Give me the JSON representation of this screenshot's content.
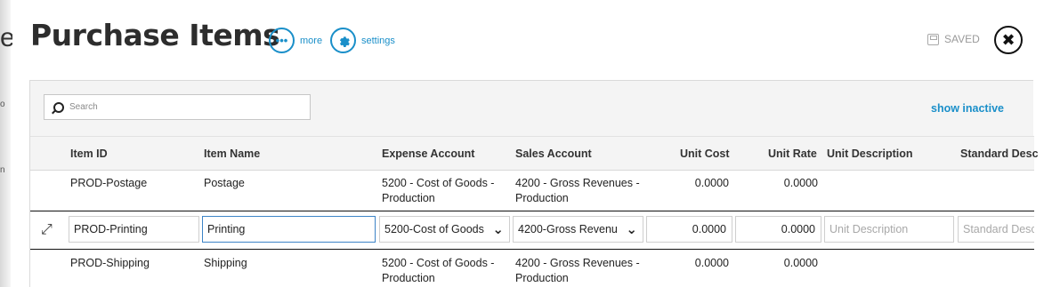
{
  "header": {
    "title": "Purchase Items",
    "more_label": "more",
    "settings_label": "settings",
    "saved_label": "SAVED",
    "more_icon": "ellipsis-icon",
    "settings_icon": "gear-icon",
    "close_icon": "close-icon"
  },
  "background_fragments": {
    "letter": "e",
    "marks": [
      "o",
      "n"
    ]
  },
  "toolbar": {
    "search_placeholder": "Search",
    "show_inactive_label": "show inactive"
  },
  "columns": [
    "Item ID",
    "Item Name",
    "Expense Account",
    "Sales Account",
    "Unit Cost",
    "Unit Rate",
    "Unit Description",
    "Standard Desc"
  ],
  "rows": [
    {
      "item_id": "PROD-Postage",
      "item_name": "Postage",
      "expense_account_1": "5200 - Cost of Goods -",
      "expense_account_2": "Production",
      "sales_account_1": "4200 - Gross Revenues -",
      "sales_account_2": "Production",
      "unit_cost": "0.0000",
      "unit_rate": "0.0000"
    },
    {
      "item_id": "PROD-Shipping",
      "item_name": "Shipping",
      "expense_account_1": "5200 - Cost of Goods -",
      "expense_account_2": "Production",
      "sales_account_1": "4200 - Gross Revenues -",
      "sales_account_2": "Production",
      "unit_cost": "0.0000",
      "unit_rate": "0.0000"
    }
  ],
  "edit_row": {
    "item_id": "PROD-Printing",
    "item_name": "Printing",
    "expense_account": "5200-Cost of Goods",
    "sales_account": "4200-Gross Revenu",
    "unit_cost": "0.0000",
    "unit_rate": "0.0000",
    "unit_description_placeholder": "Unit Description",
    "standard_description_placeholder": "Standard Desc",
    "expand_icon": "expand-icon"
  },
  "colors": {
    "accent": "#1a8fc9",
    "focus_border": "#3d84c7",
    "panel_background": "#f4f4f4"
  }
}
